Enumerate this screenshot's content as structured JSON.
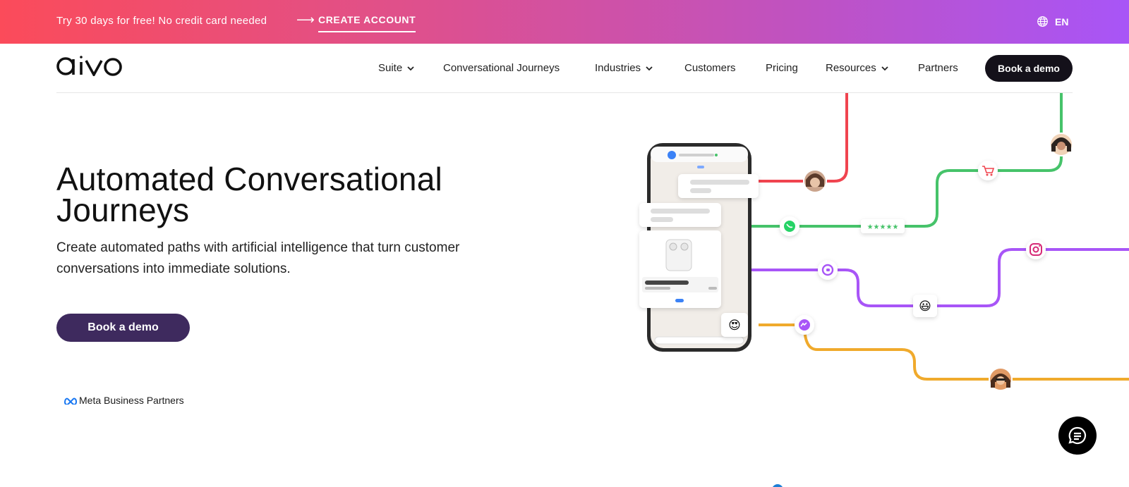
{
  "promo": {
    "text": "Try 30 days for free! No credit card needed",
    "arrow": "⟶",
    "cta": "CREATE ACCOUNT",
    "lang": "EN"
  },
  "brand": {
    "logo": "aivo"
  },
  "nav": {
    "items": [
      {
        "label": "Suite",
        "dropdown": true
      },
      {
        "label": "Conversational Journeys",
        "dropdown": false
      },
      {
        "label": "Industries",
        "dropdown": true
      },
      {
        "label": "Customers",
        "dropdown": false
      },
      {
        "label": "Pricing",
        "dropdown": false
      },
      {
        "label": "Resources",
        "dropdown": true
      },
      {
        "label": "Partners",
        "dropdown": false
      }
    ],
    "cta": "Book a demo"
  },
  "hero": {
    "title_line1": "Automated Conversational",
    "title_line2": "Journeys",
    "subtitle": "Create automated paths with artificial intelligence that turn customer conversations into immediate solutions.",
    "cta": "Book a demo",
    "badge": "Meta Business Partners"
  },
  "illustration": {
    "rating": "★★★★★",
    "emoji_smile": "😃",
    "emoji_love": "😍"
  },
  "colors": {
    "promo_start": "#fb4b5a",
    "promo_end": "#a855f7",
    "nav_cta": "#14111a",
    "hero_cta": "#3e2a5e",
    "line_red": "#f0444f",
    "line_green": "#46c36a",
    "line_purple": "#a855f7",
    "line_orange": "#f0aa2c"
  }
}
